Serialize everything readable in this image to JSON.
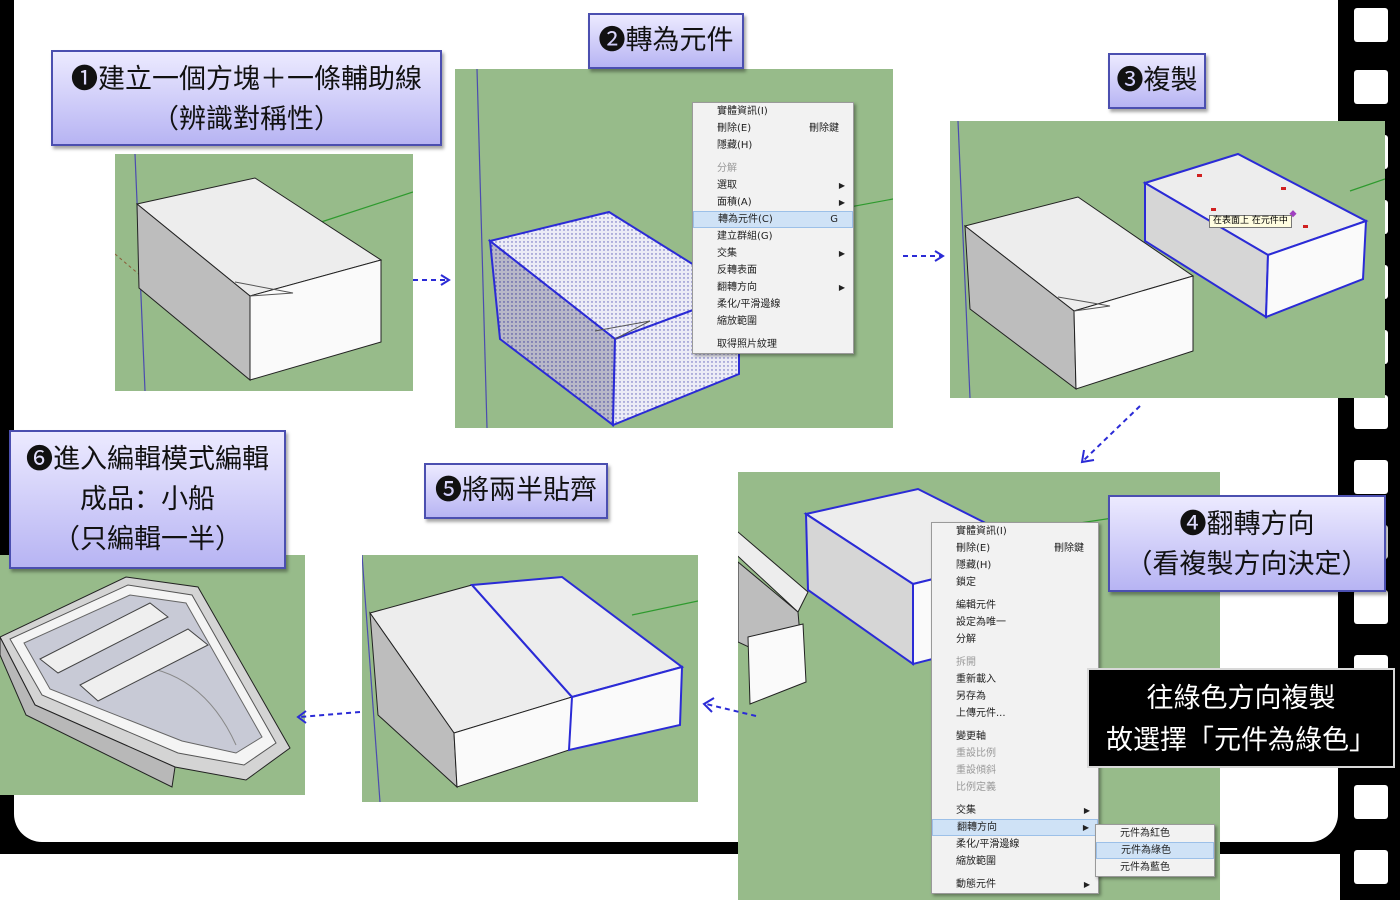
{
  "steps": {
    "step1": {
      "line1": "❶建立一個方塊＋一條輔助線",
      "line2": "（辨識對稱性）"
    },
    "step2": {
      "line1": "❷轉為元件"
    },
    "step3": {
      "line1": "❸複製"
    },
    "step4": {
      "line1": "❹翻轉方向",
      "line2": "（看複製方向決定）"
    },
    "step5": {
      "line1": "❺將兩半貼齊"
    },
    "step6": {
      "line1": "❻進入編輯模式編輯",
      "line2": "成品：小船",
      "line3": "（只編輯一半）"
    }
  },
  "menu1": {
    "items": [
      {
        "label": "實體資訊(I)"
      },
      {
        "label": "刪除(E)",
        "shortcut": "刪除鍵"
      },
      {
        "label": "隱藏(H)"
      },
      {
        "label": "分解",
        "disabled": true
      },
      {
        "label": "選取",
        "submenu": true
      },
      {
        "label": "面積(A)",
        "submenu": true
      },
      {
        "label": "轉為元件(C)",
        "shortcut": "G",
        "highlighted": true
      },
      {
        "label": "建立群組(G)"
      },
      {
        "label": "交集",
        "submenu": true
      },
      {
        "label": "反轉表面"
      },
      {
        "label": "翻轉方向",
        "submenu": true
      },
      {
        "label": "柔化/平滑邊線"
      },
      {
        "label": "縮放範圍"
      },
      {
        "label": "取得照片紋理"
      }
    ]
  },
  "menu2": {
    "items": [
      {
        "label": "實體資訊(I)"
      },
      {
        "label": "刪除(E)",
        "shortcut": "刪除鍵"
      },
      {
        "label": "隱藏(H)"
      },
      {
        "label": "鎖定"
      },
      {
        "label": "編輯元件"
      },
      {
        "label": "設定為唯一"
      },
      {
        "label": "分解"
      },
      {
        "label": "拆開",
        "disabled": true
      },
      {
        "label": "重新載入"
      },
      {
        "label": "另存為"
      },
      {
        "label": "上傳元件..."
      },
      {
        "label": "變更軸"
      },
      {
        "label": "重設比例",
        "disabled": true
      },
      {
        "label": "重設傾斜",
        "disabled": true
      },
      {
        "label": "比例定義",
        "disabled": true
      },
      {
        "label": "交集",
        "submenu": true
      },
      {
        "label": "翻轉方向",
        "submenu": true,
        "highlighted": true
      },
      {
        "label": "柔化/平滑邊線"
      },
      {
        "label": "縮放範圍"
      },
      {
        "label": "動態元件",
        "submenu": true
      }
    ]
  },
  "submenu": {
    "items": [
      {
        "label": "元件為紅色"
      },
      {
        "label": "元件為綠色",
        "highlighted": true
      },
      {
        "label": "元件為藍色"
      }
    ]
  },
  "tooltip": "在表面上 在元件中",
  "note": {
    "line1": "往綠色方向複製",
    "line2": "故選擇「元件為綠色」"
  },
  "colors": {
    "viewport_green": "#97bb8a",
    "selection_blue": "#2b2bd6",
    "label_border": "#4b4fb0"
  }
}
